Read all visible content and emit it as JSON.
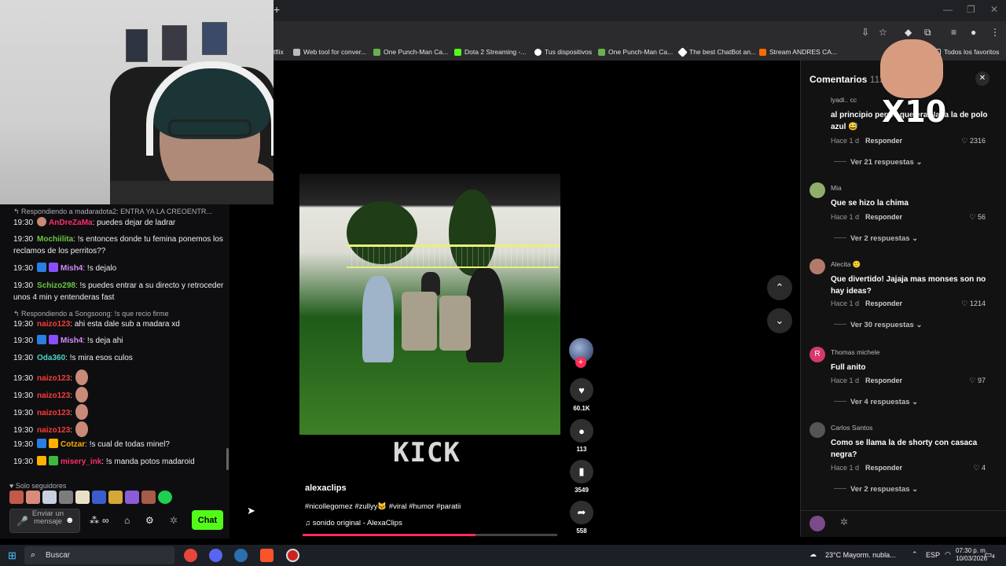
{
  "webcam": {},
  "chat": {
    "reply1": "Respondiendo a madaradota2: ENTRA YA LA CREOENTR...",
    "messages": [
      {
        "time": "19:30",
        "user": "AnDreZaMa",
        "text": ": puedes dejar de ladrar"
      },
      {
        "time": "19:30",
        "user": "Mochiilita",
        "text": ": !s entonces donde tu femina ponemos los reclamos de los perritos??"
      },
      {
        "time": "19:30",
        "user": "Mish4",
        "text": ": !s dejalo"
      },
      {
        "time": "19:30",
        "user": "Schizo298",
        "text": ": !s puedes entrar a su directo y retroceder unos 4 min y entenderas fast"
      },
      {
        "time": "19:30",
        "user": "naizo123",
        "text": ": ahi esta dale sub a madara xd"
      },
      {
        "time": "19:30",
        "user": "Mish4",
        "text": ": !s deja ahi"
      },
      {
        "time": "19:30",
        "user": "Oda360",
        "text": ": !s mira esos culos"
      },
      {
        "time": "19:30",
        "user": "naizo123",
        "text": ":"
      },
      {
        "time": "19:30",
        "user": "naizo123",
        "text": ":"
      },
      {
        "time": "19:30",
        "user": "naizo123",
        "text": ":"
      },
      {
        "time": "19:30",
        "user": "naizo123",
        "text": ":"
      },
      {
        "time": "19:30",
        "user": "Cotzar",
        "text": ": !s cual de todas minel?"
      },
      {
        "time": "19:30",
        "user": "misery_ink",
        "text": ": !s manda potos madaroid"
      }
    ],
    "reply2": "Respondiendo a Songsoong: !s que recio firme",
    "followers_only": "Solo seguidores",
    "input_placeholder": "Enviar un mensaje",
    "chat_button": "Chat"
  },
  "browser": {
    "bookmarks": [
      {
        "label": "tflix",
        "color": "#e50914"
      },
      {
        "label": "Web tool for conver...",
        "color": "#bbbbbb"
      },
      {
        "label": "One Punch-Man Ca...",
        "color": "#6ab04c"
      },
      {
        "label": "Dota 2 Streaming -...",
        "color": "#53fc18"
      },
      {
        "label": "Tus dispositivos",
        "color": "#ffffff"
      },
      {
        "label": "One Punch-Man Ca...",
        "color": "#6ab04c"
      },
      {
        "label": "The best ChatBot an...",
        "color": "#ffffff"
      },
      {
        "label": "Stream ANDRES CA...",
        "color": "#ff6a00"
      },
      {
        "label": "Todos los favoritos",
        "color": "#cccccc"
      }
    ]
  },
  "video": {
    "watermark": "KICK",
    "author": "alexaclips",
    "tags": "#nicollegomez #zullyy🐱 #viral #humor #paratii",
    "sound": "sonido original - AlexaClips",
    "progress": 0.68
  },
  "actions": {
    "likes": "60.1K",
    "comments": "113",
    "saves": "3549",
    "shares": "558"
  },
  "comments": {
    "title": "Comentarios",
    "count": "113",
    "list": [
      {
        "name": "lyadi.. cc",
        "text": "al principio pensé que era Naka la de polo azul 😅",
        "meta": "Hace 1 d",
        "reply": "Responder",
        "likes": "2316",
        "replies": "Ver 21 respuestas",
        "avatar": "#121212"
      },
      {
        "name": "Mia",
        "text": "Que se hizo la chima",
        "meta": "Hace 1 d",
        "reply": "Responder",
        "likes": "56",
        "replies": "Ver 2 respuestas",
        "avatar": "#8fae6b"
      },
      {
        "name": "Alecita 🙂",
        "text": "Que divertido! Jajaja mas monses son no hay ideas?",
        "meta": "Hace 1 d",
        "reply": "Responder",
        "likes": "1214",
        "replies": "Ver 30 respuestas",
        "avatar": "#b37a6a"
      },
      {
        "name": "Thomas michele",
        "text": "Full anito",
        "meta": "Hace 1 d",
        "reply": "Responder",
        "likes": "97",
        "replies": "Ver 4 respuestas",
        "avatar": "#d63a6a"
      },
      {
        "name": "Carlos Santos",
        "text": "Como se llama la de shorty con casaca negra?",
        "meta": "Hace 1 d",
        "reply": "Responder",
        "likes": "4",
        "replies": "Ver 2 respuestas",
        "avatar": "#555555"
      }
    ],
    "avatar_initial_R": "R"
  },
  "meme": {
    "overlay": "X10"
  },
  "taskbar": {
    "search": "Buscar",
    "weather": "23°C  Mayorm. nubla...",
    "lang": "ESP",
    "time": "07:30 p. m.",
    "date": "10/03/2026",
    "notif": "4"
  }
}
